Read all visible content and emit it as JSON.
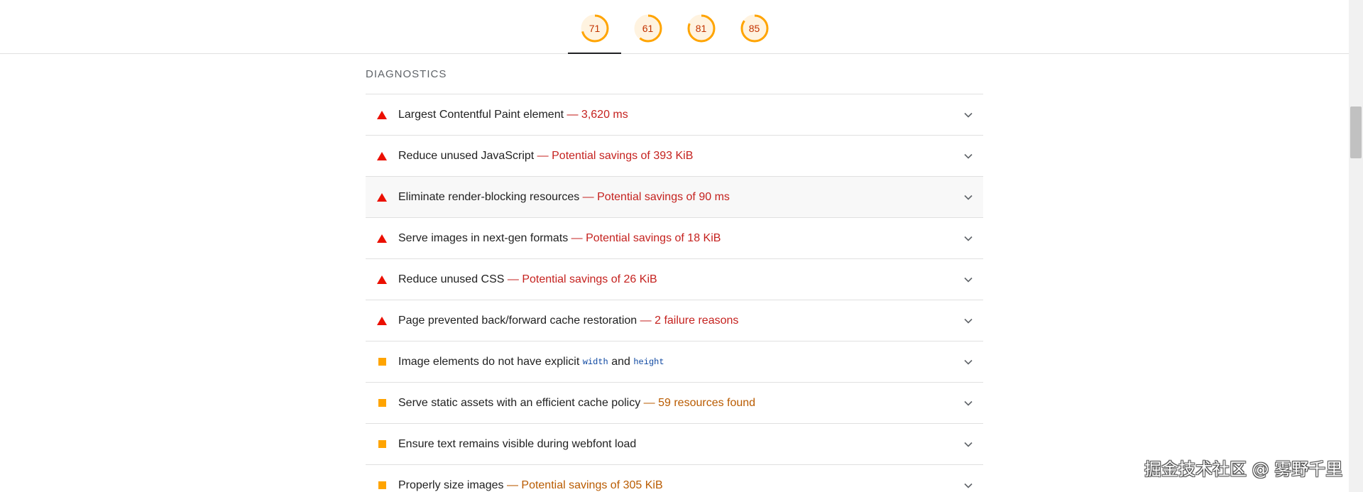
{
  "scores": [
    {
      "value": "71",
      "fraction": 0.71,
      "active": true
    },
    {
      "value": "61",
      "fraction": 0.61,
      "active": false
    },
    {
      "value": "81",
      "fraction": 0.81,
      "active": false
    },
    {
      "value": "85",
      "fraction": 0.85,
      "active": false
    }
  ],
  "colors": {
    "gauge_average": "#ffa400",
    "gauge_track": "#fff3e0",
    "fail_text": "#c5221f",
    "fail_icon": "#eb0f00",
    "average_icon": "#ffa400",
    "average_text": "#b95b00"
  },
  "diagnostics": {
    "title": "DIAGNOSTICS",
    "separator": " — ",
    "items": [
      {
        "status": "fail",
        "title": "Largest Contentful Paint element",
        "detail": "3,620 ms"
      },
      {
        "status": "fail",
        "title": "Reduce unused JavaScript",
        "detail": "Potential savings of 393 KiB"
      },
      {
        "status": "fail",
        "title": "Eliminate render-blocking resources",
        "detail": "Potential savings of 90 ms"
      },
      {
        "status": "fail",
        "title": "Serve images in next-gen formats",
        "detail": "Potential savings of 18 KiB"
      },
      {
        "status": "fail",
        "title": "Reduce unused CSS",
        "detail": "Potential savings of 26 KiB"
      },
      {
        "status": "fail",
        "title": "Page prevented back/forward cache restoration",
        "detail": "2 failure reasons"
      },
      {
        "status": "average",
        "title": "Image elements do not have explicit",
        "code1": "width",
        "and": "and",
        "code2": "height"
      },
      {
        "status": "average",
        "title": "Serve static assets with an efficient cache policy",
        "detail": "59 resources found"
      },
      {
        "status": "average",
        "title": "Ensure text remains visible during webfont load"
      },
      {
        "status": "average",
        "title": "Properly size images",
        "detail": "Potential savings of 305 KiB"
      }
    ]
  },
  "icons": {
    "fail": "warning-triangle-icon",
    "average": "average-square-icon",
    "expand": "chevron-down-icon"
  },
  "watermark": "掘金技术社区 @ 雾野千里"
}
